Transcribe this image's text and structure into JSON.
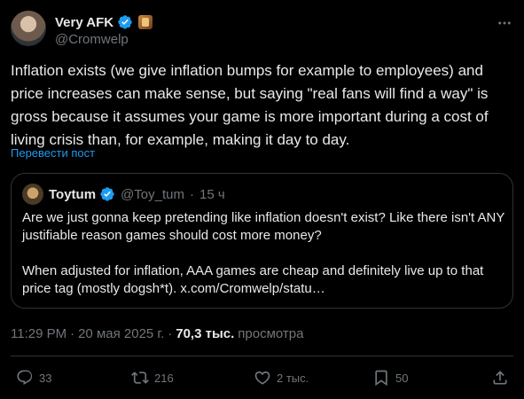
{
  "author": {
    "name": "Very AFK",
    "handle": "@Cromwelp"
  },
  "tweet": {
    "text": "Inflation exists (we give inflation bumps for example to employees) and price increases can make sense, but saying \"real fans will find a way\" is gross because it assumes your game is more important during a cost of living crisis than, for example, making it day to day.",
    "translate_label": "Перевести пост"
  },
  "quote": {
    "name": "Toytum",
    "handle": "@Toy_tum",
    "separator": "·",
    "time": "15 ч",
    "paragraph1": "Are we just gonna keep pretending like inflation doesn't exist? Like there isn't ANY justifiable reason games should cost more money?",
    "paragraph2": "When adjusted for inflation, AAA games are cheap and definitely live up to that price tag (mostly dogsh*t). x.com/Cromwelp/statu…"
  },
  "meta": {
    "time": "11:29 PM",
    "separator": "·",
    "date": "20 мая 2025 г.",
    "dot": "·",
    "views": "70,3 тыс.",
    "views_label": "просмотра"
  },
  "actions": {
    "replies": "33",
    "reposts": "216",
    "likes": "2 тыс.",
    "bookmarks": "50"
  },
  "colors": {
    "background": "#000000",
    "text": "#e7e9ea",
    "muted": "#71767b",
    "accent": "#1d9bf0",
    "border": "#2f3336"
  }
}
